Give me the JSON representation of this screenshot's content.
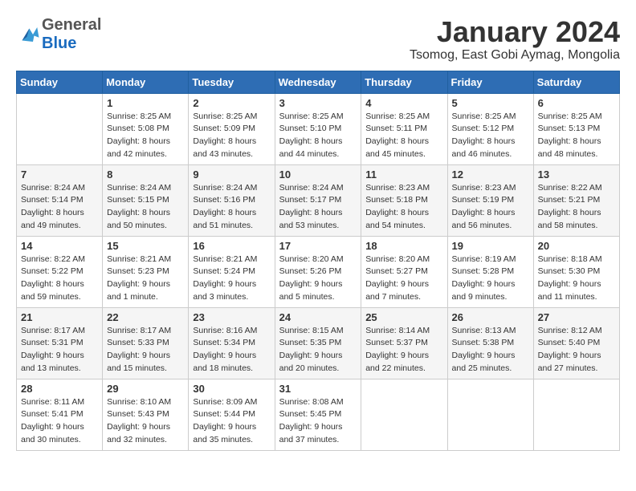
{
  "header": {
    "logo": {
      "general": "General",
      "blue": "Blue",
      "tagline": ""
    },
    "title": "January 2024",
    "location": "Tsomog, East Gobi Aymag, Mongolia"
  },
  "calendar": {
    "weekdays": [
      "Sunday",
      "Monday",
      "Tuesday",
      "Wednesday",
      "Thursday",
      "Friday",
      "Saturday"
    ],
    "weeks": [
      [
        {
          "day": "",
          "info": ""
        },
        {
          "day": "1",
          "info": "Sunrise: 8:25 AM\nSunset: 5:08 PM\nDaylight: 8 hours\nand 42 minutes."
        },
        {
          "day": "2",
          "info": "Sunrise: 8:25 AM\nSunset: 5:09 PM\nDaylight: 8 hours\nand 43 minutes."
        },
        {
          "day": "3",
          "info": "Sunrise: 8:25 AM\nSunset: 5:10 PM\nDaylight: 8 hours\nand 44 minutes."
        },
        {
          "day": "4",
          "info": "Sunrise: 8:25 AM\nSunset: 5:11 PM\nDaylight: 8 hours\nand 45 minutes."
        },
        {
          "day": "5",
          "info": "Sunrise: 8:25 AM\nSunset: 5:12 PM\nDaylight: 8 hours\nand 46 minutes."
        },
        {
          "day": "6",
          "info": "Sunrise: 8:25 AM\nSunset: 5:13 PM\nDaylight: 8 hours\nand 48 minutes."
        }
      ],
      [
        {
          "day": "7",
          "info": "Sunrise: 8:24 AM\nSunset: 5:14 PM\nDaylight: 8 hours\nand 49 minutes."
        },
        {
          "day": "8",
          "info": "Sunrise: 8:24 AM\nSunset: 5:15 PM\nDaylight: 8 hours\nand 50 minutes."
        },
        {
          "day": "9",
          "info": "Sunrise: 8:24 AM\nSunset: 5:16 PM\nDaylight: 8 hours\nand 51 minutes."
        },
        {
          "day": "10",
          "info": "Sunrise: 8:24 AM\nSunset: 5:17 PM\nDaylight: 8 hours\nand 53 minutes."
        },
        {
          "day": "11",
          "info": "Sunrise: 8:23 AM\nSunset: 5:18 PM\nDaylight: 8 hours\nand 54 minutes."
        },
        {
          "day": "12",
          "info": "Sunrise: 8:23 AM\nSunset: 5:19 PM\nDaylight: 8 hours\nand 56 minutes."
        },
        {
          "day": "13",
          "info": "Sunrise: 8:22 AM\nSunset: 5:21 PM\nDaylight: 8 hours\nand 58 minutes."
        }
      ],
      [
        {
          "day": "14",
          "info": "Sunrise: 8:22 AM\nSunset: 5:22 PM\nDaylight: 8 hours\nand 59 minutes."
        },
        {
          "day": "15",
          "info": "Sunrise: 8:21 AM\nSunset: 5:23 PM\nDaylight: 9 hours\nand 1 minute."
        },
        {
          "day": "16",
          "info": "Sunrise: 8:21 AM\nSunset: 5:24 PM\nDaylight: 9 hours\nand 3 minutes."
        },
        {
          "day": "17",
          "info": "Sunrise: 8:20 AM\nSunset: 5:26 PM\nDaylight: 9 hours\nand 5 minutes."
        },
        {
          "day": "18",
          "info": "Sunrise: 8:20 AM\nSunset: 5:27 PM\nDaylight: 9 hours\nand 7 minutes."
        },
        {
          "day": "19",
          "info": "Sunrise: 8:19 AM\nSunset: 5:28 PM\nDaylight: 9 hours\nand 9 minutes."
        },
        {
          "day": "20",
          "info": "Sunrise: 8:18 AM\nSunset: 5:30 PM\nDaylight: 9 hours\nand 11 minutes."
        }
      ],
      [
        {
          "day": "21",
          "info": "Sunrise: 8:17 AM\nSunset: 5:31 PM\nDaylight: 9 hours\nand 13 minutes."
        },
        {
          "day": "22",
          "info": "Sunrise: 8:17 AM\nSunset: 5:33 PM\nDaylight: 9 hours\nand 15 minutes."
        },
        {
          "day": "23",
          "info": "Sunrise: 8:16 AM\nSunset: 5:34 PM\nDaylight: 9 hours\nand 18 minutes."
        },
        {
          "day": "24",
          "info": "Sunrise: 8:15 AM\nSunset: 5:35 PM\nDaylight: 9 hours\nand 20 minutes."
        },
        {
          "day": "25",
          "info": "Sunrise: 8:14 AM\nSunset: 5:37 PM\nDaylight: 9 hours\nand 22 minutes."
        },
        {
          "day": "26",
          "info": "Sunrise: 8:13 AM\nSunset: 5:38 PM\nDaylight: 9 hours\nand 25 minutes."
        },
        {
          "day": "27",
          "info": "Sunrise: 8:12 AM\nSunset: 5:40 PM\nDaylight: 9 hours\nand 27 minutes."
        }
      ],
      [
        {
          "day": "28",
          "info": "Sunrise: 8:11 AM\nSunset: 5:41 PM\nDaylight: 9 hours\nand 30 minutes."
        },
        {
          "day": "29",
          "info": "Sunrise: 8:10 AM\nSunset: 5:43 PM\nDaylight: 9 hours\nand 32 minutes."
        },
        {
          "day": "30",
          "info": "Sunrise: 8:09 AM\nSunset: 5:44 PM\nDaylight: 9 hours\nand 35 minutes."
        },
        {
          "day": "31",
          "info": "Sunrise: 8:08 AM\nSunset: 5:45 PM\nDaylight: 9 hours\nand 37 minutes."
        },
        {
          "day": "",
          "info": ""
        },
        {
          "day": "",
          "info": ""
        },
        {
          "day": "",
          "info": ""
        }
      ]
    ]
  }
}
